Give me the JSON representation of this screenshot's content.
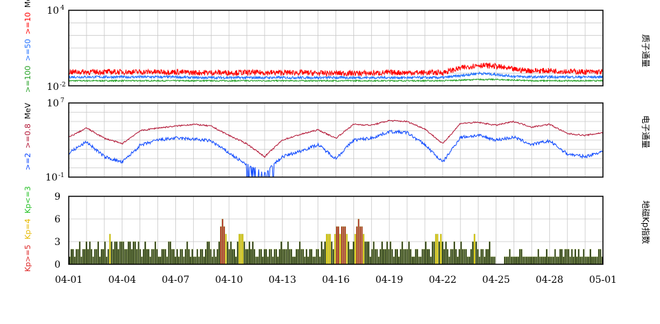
{
  "colors": {
    "proton_ge10": "#ff0000",
    "proton_ge50": "#1e6fff",
    "proton_ge100": "#22a022",
    "electron_ge08": "#b01030",
    "electron_ge2": "#0a46ff",
    "kp_ge5": "#b41e1e",
    "kp_eq4": "#e6c800",
    "kp_le3": "#1a2a12",
    "grid": "#c8c8c8"
  },
  "x_axis": {
    "ticks": [
      "04-01",
      "04-04",
      "04-07",
      "04-10",
      "04-13",
      "04-16",
      "04-19",
      "04-22",
      "04-25",
      "04-28",
      "05-01"
    ],
    "days": 30
  },
  "panels": {
    "proton": {
      "side_label": "质子通量",
      "unit": "MeV",
      "y_top": {
        "base": "10",
        "exp": "4"
      },
      "y_bottom": {
        "base": "10",
        "exp": "-2"
      },
      "legend": [
        {
          "text": ">=100",
          "color": "#22a022"
        },
        {
          "text": ">=50",
          "color": "#1e6fff"
        },
        {
          "text": ">=10",
          "color": "#ff0000"
        }
      ]
    },
    "electron": {
      "side_label": "电子通量",
      "unit": "MeV",
      "y_top": {
        "base": "10",
        "exp": "7"
      },
      "y_bottom": {
        "base": "10",
        "exp": "-1"
      },
      "legend": [
        {
          "text": ">=2",
          "color": "#0a46ff"
        },
        {
          "text": ">=0.8",
          "color": "#b01030"
        }
      ]
    },
    "kp": {
      "side_label": "地磁Kp指数",
      "legend": [
        {
          "text": "Kp>=5",
          "color": "#dd2222"
        },
        {
          "text": "Kp=4",
          "color": "#e6b800"
        },
        {
          "text": "Kp<=3",
          "color": "#22c022"
        }
      ],
      "yticks": [
        "0",
        "3",
        "6",
        "9"
      ]
    }
  },
  "chart_data": [
    {
      "type": "line",
      "title": "",
      "ylabel": "MeV",
      "yscale": "log",
      "ylim": [
        0.01,
        10000
      ],
      "xlim": [
        "04-01",
        "05-01"
      ],
      "grid": true,
      "series": [
        {
          "name": ">=10",
          "approx_level_log10": [
            -0.9,
            -0.9,
            -0.9,
            -0.9,
            -0.9,
            -0.9,
            -0.9,
            -0.95,
            -0.95,
            -0.95,
            -0.95,
            -0.95,
            -0.95,
            -0.95,
            -1.0,
            -1.0,
            -1.0,
            -1.0,
            -0.95,
            -0.95,
            -0.95,
            -0.95,
            -0.6,
            -0.35,
            -0.45,
            -0.7,
            -0.8,
            -0.8,
            -0.85,
            -0.9,
            -0.9
          ]
        },
        {
          "name": ">=50",
          "approx_level_log10": [
            -1.3,
            -1.3,
            -1.3,
            -1.3,
            -1.3,
            -1.3,
            -1.3,
            -1.35,
            -1.35,
            -1.35,
            -1.35,
            -1.35,
            -1.35,
            -1.35,
            -1.35,
            -1.35,
            -1.35,
            -1.35,
            -1.35,
            -1.35,
            -1.35,
            -1.35,
            -1.2,
            -1.0,
            -1.1,
            -1.25,
            -1.3,
            -1.3,
            -1.3,
            -1.3,
            -1.3
          ]
        },
        {
          "name": ">=100",
          "approx_level_log10": [
            -1.6,
            -1.6,
            -1.6,
            -1.6,
            -1.6,
            -1.6,
            -1.6,
            -1.6,
            -1.6,
            -1.6,
            -1.6,
            -1.6,
            -1.6,
            -1.6,
            -1.6,
            -1.6,
            -1.6,
            -1.6,
            -1.6,
            -1.6,
            -1.6,
            -1.6,
            -1.55,
            -1.5,
            -1.5,
            -1.55,
            -1.6,
            -1.6,
            -1.6,
            -1.6,
            -1.6
          ]
        }
      ]
    },
    {
      "type": "line",
      "title": "",
      "ylabel": "MeV",
      "yscale": "log",
      "ylim": [
        0.1,
        10000000
      ],
      "xlim": [
        "04-01",
        "05-01"
      ],
      "grid": true,
      "series": [
        {
          "name": ">=0.8",
          "approx_level_log10": [
            3.3,
            4.3,
            3.2,
            2.6,
            4.0,
            4.3,
            4.5,
            4.7,
            4.5,
            3.5,
            2.6,
            1.2,
            3.0,
            3.6,
            4.1,
            3.2,
            4.7,
            4.6,
            5.1,
            5.0,
            4.2,
            2.6,
            4.8,
            4.9,
            4.6,
            5.0,
            4.4,
            4.7,
            3.7,
            3.5,
            3.8
          ]
        },
        {
          "name": ">=2",
          "approx_level_log10": [
            1.6,
            2.8,
            1.2,
            0.6,
            2.4,
            3.0,
            3.2,
            3.1,
            2.9,
            1.6,
            0.3,
            -0.5,
            1.2,
            1.8,
            2.5,
            1.0,
            3.0,
            3.2,
            3.9,
            3.8,
            2.5,
            0.6,
            3.3,
            3.5,
            3.0,
            3.3,
            2.5,
            2.9,
            1.5,
            1.2,
            1.8
          ]
        }
      ]
    },
    {
      "type": "bar",
      "title": "",
      "ylabel": "",
      "ylim": [
        0,
        9
      ],
      "x_step_hours": 3,
      "values": [
        1,
        2,
        2,
        1,
        2,
        2,
        3,
        1,
        2,
        2,
        3,
        2,
        3,
        2,
        1,
        2,
        2,
        3,
        1,
        2,
        2,
        3,
        1,
        2,
        4,
        3,
        2,
        3,
        3,
        2,
        3,
        3,
        3,
        2,
        2,
        3,
        3,
        2,
        3,
        3,
        2,
        3,
        2,
        1,
        2,
        3,
        2,
        2,
        1,
        2,
        2,
        3,
        2,
        1,
        1,
        2,
        2,
        2,
        1,
        3,
        3,
        2,
        2,
        1,
        2,
        1,
        2,
        2,
        1,
        2,
        3,
        2,
        1,
        2,
        1,
        1,
        2,
        1,
        2,
        2,
        1,
        2,
        3,
        3,
        2,
        1,
        2,
        1,
        2,
        3,
        5,
        6,
        5,
        4,
        3,
        2,
        3,
        2,
        2,
        1,
        3,
        4,
        4,
        4,
        3,
        2,
        2,
        3,
        2,
        3,
        2,
        1,
        1,
        2,
        2,
        1,
        2,
        2,
        1,
        2,
        2,
        1,
        2,
        2,
        1,
        2,
        3,
        2,
        2,
        2,
        3,
        2,
        2,
        1,
        1,
        2,
        2,
        3,
        2,
        2,
        1,
        2,
        1,
        2,
        2,
        1,
        1,
        2,
        2,
        1,
        3,
        2,
        3,
        4,
        4,
        4,
        3,
        2,
        4,
        5,
        5,
        4,
        5,
        5,
        5,
        4,
        3,
        2,
        2,
        3,
        4,
        5,
        6,
        5,
        5,
        4,
        3,
        3,
        3,
        1,
        2,
        3,
        2,
        2,
        1,
        2,
        3,
        2,
        2,
        3,
        2,
        3,
        2,
        1,
        2,
        2,
        1,
        2,
        3,
        2,
        2,
        2,
        3,
        2,
        1,
        1,
        2,
        2,
        1,
        1,
        2,
        2,
        3,
        2,
        2,
        1,
        3,
        3,
        4,
        4,
        3,
        4,
        3,
        2,
        3,
        2,
        1,
        2,
        2,
        3,
        2,
        1,
        2,
        3,
        2,
        2,
        2,
        1,
        1,
        2,
        3,
        4,
        3,
        2,
        1,
        2,
        2,
        1,
        2,
        2,
        3,
        1,
        1,
        1,
        0,
        0,
        0,
        0,
        0,
        1,
        1,
        1,
        2,
        1,
        1,
        1,
        1,
        1,
        2,
        2,
        1,
        1,
        1,
        1,
        1,
        1,
        1,
        1,
        1,
        2,
        1,
        1,
        1,
        1,
        2,
        1,
        1,
        1,
        1,
        2,
        1,
        1,
        2,
        2,
        1,
        2,
        2,
        2,
        1,
        2,
        1,
        2,
        1,
        2,
        1,
        1,
        2,
        1,
        1,
        1,
        2,
        1,
        1,
        1,
        1,
        2,
        2,
        1
      ]
    }
  ]
}
